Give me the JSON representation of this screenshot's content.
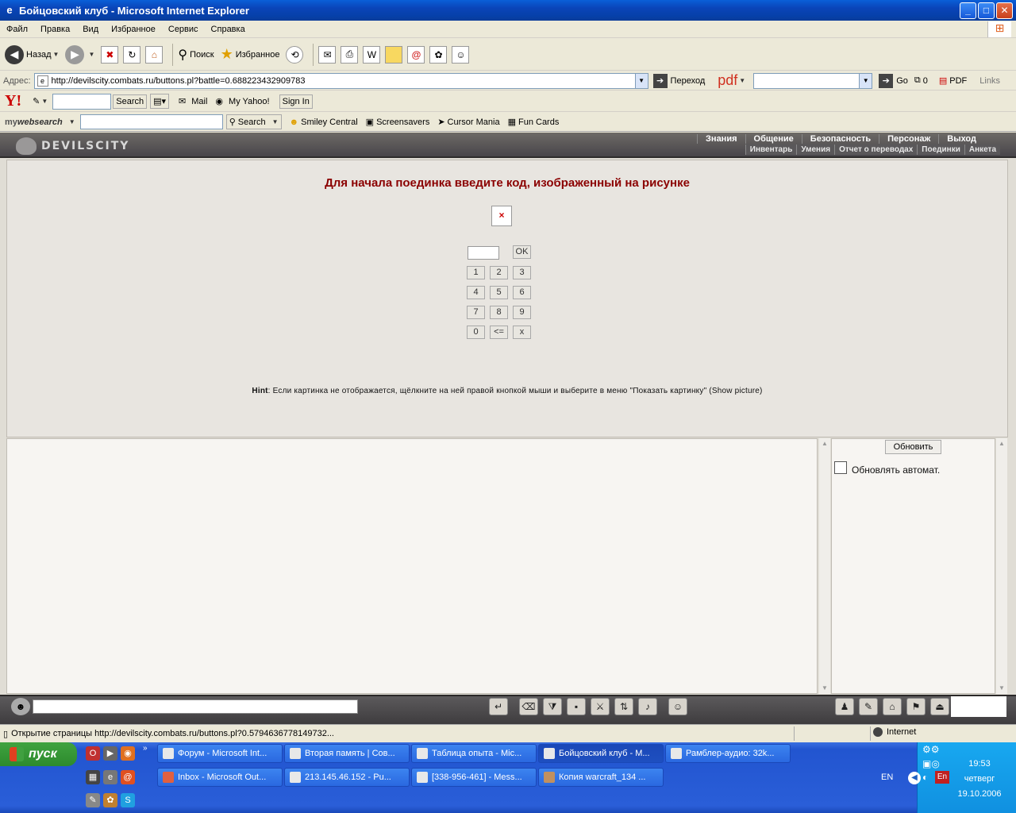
{
  "window": {
    "title": "Бойцовский клуб - Microsoft Internet Explorer",
    "buttons": [
      "_",
      "□",
      "✕"
    ]
  },
  "menu": [
    "Файл",
    "Правка",
    "Вид",
    "Избранное",
    "Сервис",
    "Справка"
  ],
  "toolbar": {
    "back": "Назад",
    "search": "Поиск",
    "favorites": "Избранное"
  },
  "address": {
    "label": "Адрес:",
    "url": "http://devilscity.combats.ru/buttons.pl?battle=0.688223432909783",
    "go": "Переход",
    "pdf": "pdf",
    "go2": "Go",
    "count": "0",
    "pdf_btn": "PDF",
    "links": "Links"
  },
  "yahoo": {
    "logo": "Y!",
    "search": "Search",
    "mail": "Mail",
    "my_yahoo": "My Yahoo!",
    "sign_in": "Sign In"
  },
  "mywebsearch": {
    "logo_prefix": "my",
    "logo_main": "websearch",
    "search": "Search",
    "items": [
      "Smiley Central",
      "Screensavers",
      "Cursor Mania",
      "Fun Cards"
    ]
  },
  "game": {
    "logo": "DEVILSCITY",
    "nav_top": [
      "Знания",
      "Общение",
      "Безопасность",
      "Персонаж",
      "Выход"
    ],
    "nav_bottom": [
      "Инвентарь",
      "Умения",
      "Отчет о переводах",
      "Поединки",
      "Анкета"
    ],
    "title": "Для начала поединка введите код, изображенный на рисунке",
    "ok": "OK",
    "keys": [
      "1",
      "2",
      "3",
      "4",
      "5",
      "6",
      "7",
      "8",
      "9",
      "0",
      "<=",
      "x"
    ],
    "hint_label": "Hint",
    "hint_text": ": Если картинка не отображается, щёлкните на ней правой кнопкой мыши и выберите в меню \"Показать картинку\" (Show picture)",
    "refresh": "Обновить",
    "auto_refresh": "Обновлять автомат."
  },
  "status": {
    "text": "Открытие страницы http://devilscity.combats.ru/buttons.pl?0.5794636778149732...",
    "zone": "Internet"
  },
  "taskbar": {
    "start": "пуск",
    "tasks_row1": [
      "Форум - Microsoft Int...",
      "Вторая память | Сов...",
      "Таблица опыта - Mic...",
      "Бойцовский клуб - M...",
      "Рамблер-аудио: 32k..."
    ],
    "tasks_row2": [
      "Inbox - Microsoft Out...",
      "213.145.46.152 - Pu...",
      "[338-956-461] - Mess...",
      "Копия warcraft_134 ..."
    ],
    "lang": "EN",
    "lang2": "En",
    "time": "19:53",
    "day": "четверг",
    "date": "19.10.2006"
  }
}
